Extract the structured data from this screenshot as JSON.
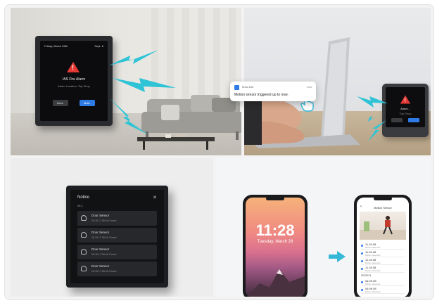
{
  "panel_1": {
    "status_left": "Friday, March 28th",
    "status_right": "Sept. 6",
    "alert_title": "IAS Fire Alarm",
    "alert_subtitle": "Alarm Location: Top Shop",
    "button_left": "Back",
    "button_right": "Mute"
  },
  "panel_2": {
    "device_alert_title": "Alarm...",
    "device_alert_sub": "Top Shop"
  },
  "panel_3": {
    "title": "Notice",
    "close": "✕",
    "subtitle": "08-1",
    "rows": [
      {
        "title": "Door Sensor",
        "detail": "08-18 17:08:46 Closed"
      },
      {
        "title": "Door Sensor",
        "detail": "08-18 17:08:46 Closed"
      },
      {
        "title": "Door Sensor",
        "detail": "08-18 17:08:46 Closed"
      },
      {
        "title": "Door Sensor",
        "detail": "08-18 17:08:46 Closed"
      }
    ]
  },
  "panel_4": {
    "lock_time": "11:28",
    "lock_date": "Tuesday, March 28",
    "push_app": "Imou Life",
    "push_time": "now",
    "push_message": "Motion sensor triggered up to now.",
    "app_header": "Motion Sensor",
    "list": [
      {
        "date": "11.28.08",
        "state": "Motion detected"
      },
      {
        "date": "11.28.08",
        "state": "Motion detected"
      },
      {
        "date": "11.28.08",
        "state": "Motion detected"
      },
      {
        "date": "11.28.08",
        "state": "Motion detected"
      },
      {
        "date": "06.09.08",
        "state": "Motion detected"
      },
      {
        "date": "06.09.08",
        "state": "Motion detected"
      }
    ],
    "section_label": "2023/11"
  },
  "colors": {
    "alarm_red": "#e53935",
    "signal_cyan": "#2ec4d6",
    "mute_blue": "#2f7be5",
    "arrow_teal": "#35b8d8"
  }
}
